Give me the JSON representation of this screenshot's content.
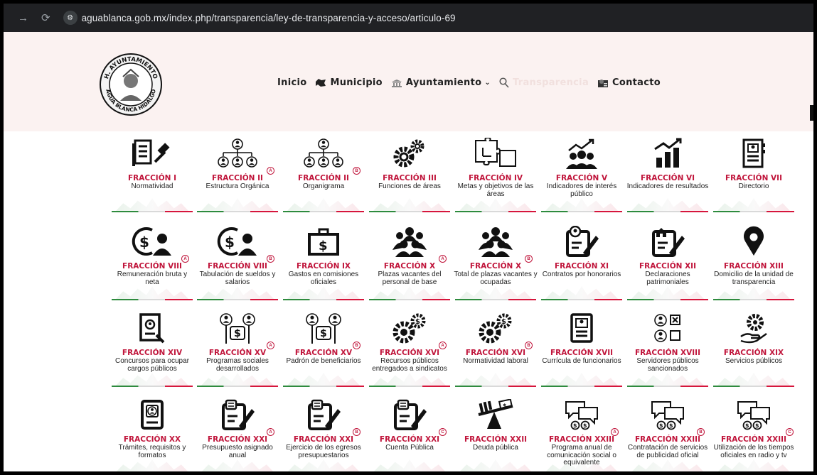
{
  "browser": {
    "url": "aguablanca.gob.mx/index.php/transparencia/ley-de-transparencia-y-acceso/articulo-69"
  },
  "header": {
    "seal_text_top": "H. AYUNTAMIENTO",
    "seal_text_bottom": "AGUA BLANCA HIDALGO",
    "menu": {
      "inicio": "Inicio",
      "municipio": "Municipio",
      "ayuntamiento": "Ayuntamiento",
      "transparencia": "Transparencia",
      "contacto": "Contacto"
    }
  },
  "colors": {
    "accent": "#c0153b",
    "header_bg": "#fbf2f1",
    "green": "#2e8b3e"
  },
  "rows": [
    [
      {
        "title": "FRACCIÓN I",
        "desc": "Normatividad",
        "badge": "",
        "icon": "document-gavel-icon"
      },
      {
        "title": "FRACCIÓN II",
        "desc": "Estructura Orgánica",
        "badge": "A",
        "icon": "org-structure-icon"
      },
      {
        "title": "FRACCIÓN II",
        "desc": "Organigrama",
        "badge": "B",
        "icon": "org-chart-icon"
      },
      {
        "title": "FRACCIÓN III",
        "desc": "Funciones de áreas",
        "badge": "",
        "icon": "gears-icon"
      },
      {
        "title": "FRACCIÓN IV",
        "desc": "Metas y objetivos de las áreas",
        "badge": "",
        "icon": "puzzle-icon"
      },
      {
        "title": "FRACCIÓN V",
        "desc": "Indicadores de interés público",
        "badge": "",
        "icon": "group-growth-icon"
      },
      {
        "title": "FRACCIÓN VI",
        "desc": "Indicadores de resultados",
        "badge": "",
        "icon": "bar-chart-icon"
      },
      {
        "title": "FRACCIÓN VII",
        "desc": "Directorio",
        "badge": "",
        "icon": "contact-book-icon"
      }
    ],
    [
      {
        "title": "FRACCIÓN VIII",
        "desc": "Remuneración bruta y neta",
        "badge": "A",
        "icon": "salary-person-icon"
      },
      {
        "title": "FRACCIÓN VIII",
        "desc": "Tabulación de sueldos y salarios",
        "badge": "B",
        "icon": "salary-person-icon"
      },
      {
        "title": "FRACCIÓN IX",
        "desc": "Gastos en comisiones oficiales",
        "badge": "",
        "icon": "money-case-icon"
      },
      {
        "title": "FRACCIÓN X",
        "desc": "Plazas vacantes del personal de base",
        "badge": "A",
        "icon": "group-icon"
      },
      {
        "title": "FRACCIÓN X",
        "desc": "Total de plazas vacantes y ocupadas",
        "badge": "B",
        "icon": "group-icon"
      },
      {
        "title": "FRACCIÓN XI",
        "desc": "Contratos por honorarios",
        "badge": "",
        "icon": "contract-edit-icon"
      },
      {
        "title": "FRACCIÓN XII",
        "desc": "Declaraciones patrimoniales",
        "badge": "",
        "icon": "house-declaration-icon"
      },
      {
        "title": "FRACCIÓN XIII",
        "desc": "Domicilio de la unidad de transparencia",
        "badge": "",
        "icon": "map-pin-icon"
      }
    ],
    [
      {
        "title": "FRACCIÓN XIV",
        "desc": "Concursos para ocupar cargos públicos",
        "badge": "",
        "icon": "document-search-icon"
      },
      {
        "title": "FRACCIÓN XV",
        "desc": "Programas sociales desarrollados",
        "badge": "A",
        "icon": "people-money-icon"
      },
      {
        "title": "FRACCIÓN XV",
        "desc": "Padrón de beneficiarios",
        "badge": "B",
        "icon": "people-money-icon"
      },
      {
        "title": "FRACCIÓN XVI",
        "desc": "Recursos públicos entregados a sindicatos",
        "badge": "A",
        "icon": "money-gears-icon"
      },
      {
        "title": "FRACCIÓN XVI",
        "desc": "Normatividad laboral",
        "badge": "B",
        "icon": "money-gears-icon"
      },
      {
        "title": "FRACCIÓN XVII",
        "desc": "Currícula de funcionarios",
        "badge": "",
        "icon": "resume-icon"
      },
      {
        "title": "FRACCIÓN XVIII",
        "desc": "Servidores públicos sancionados",
        "badge": "",
        "icon": "people-checkbox-icon"
      },
      {
        "title": "FRACCIÓN XIX",
        "desc": "Servicios públicos",
        "badge": "",
        "icon": "service-hand-icon"
      }
    ],
    [
      {
        "title": "FRACCIÓN XX",
        "desc": "Trámites, requisitos y formatos",
        "badge": "",
        "icon": "id-form-icon"
      },
      {
        "title": "FRACCIÓN XXI",
        "desc": "Presupuesto asignado anual",
        "badge": "A",
        "icon": "budget-edit-icon"
      },
      {
        "title": "FRACCIÓN XXI",
        "desc": "Ejercicio de los egresos presupuestarios",
        "badge": "B",
        "icon": "budget-edit-icon"
      },
      {
        "title": "FRACCIÓN XXI",
        "desc": "Cuenta Pública",
        "badge": "C",
        "icon": "budget-edit-icon"
      },
      {
        "title": "FRACCIÓN XXII",
        "desc": "Deuda pública",
        "badge": "",
        "icon": "debt-scale-icon"
      },
      {
        "title": "FRACCIÓN XXIII",
        "desc": "Programa anual de comunicación social o equivalente",
        "badge": "A",
        "icon": "chat-money-icon"
      },
      {
        "title": "FRACCIÓN XXIII",
        "desc": "Contratación de servicios de publicidad oficial",
        "badge": "B",
        "icon": "chat-money-icon"
      },
      {
        "title": "FRACCIÓN XXIII",
        "desc": "Utilización de los tiempos oficiales en radio y tv",
        "badge": "C",
        "icon": "chat-money-icon"
      }
    ]
  ]
}
